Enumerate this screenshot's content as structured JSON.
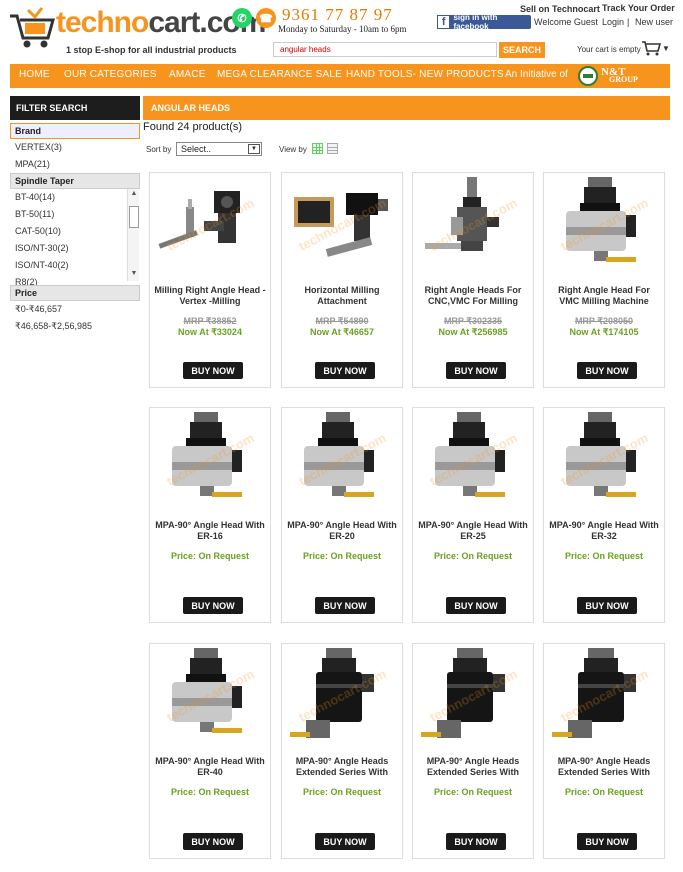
{
  "header": {
    "logo_text_a": "techno",
    "logo_text_b": "cart.com",
    "tagline": "1 stop E-shop for all industrial products",
    "phone_number": "9361 77 87 97",
    "phone_hours": "Monday to Saturday - 10am to 6pm",
    "sell_link": "Sell on Technocart",
    "track_link": "Track Your Order",
    "fb_button": "sign in with facebook",
    "welcome": "Welcome Guest",
    "login": "Login",
    "separator": "|",
    "new_user": "New user",
    "search_value": "angular heads",
    "search_button": "SEARCH",
    "cart_status": "Your cart is empty",
    "whatsapp_icon": "whatsapp-icon",
    "phone_icon": "phone-icon",
    "cart_icon": "shopping-cart-icon"
  },
  "nav": {
    "items": [
      "HOME",
      "OUR CATEGORIES",
      "AMACE",
      "MEGA CLEARANCE SALE",
      "HAND TOOLS- NEW PRODUCTS"
    ],
    "initiative": "An Initiative of",
    "group_logo_l1": "N&T",
    "group_logo_l2": "GROUP"
  },
  "sidebar": {
    "filter_header": "FILTER SEARCH",
    "brand_title": "Brand",
    "brands": [
      "VERTEX(3)",
      "MPA(21)"
    ],
    "taper_title": "Spindle Taper",
    "tapers": [
      "BT-40(14)",
      "BT-50(11)",
      "CAT-50(10)",
      "ISO/NT-30(2)",
      "ISO/NT-40(2)",
      "R8(2)"
    ],
    "price_title": "Price",
    "prices": [
      "₹0-₹46,657",
      "₹46,658-₹2,56,985"
    ]
  },
  "main": {
    "category": "ANGULAR HEADS",
    "found": "Found 24 product(s)",
    "sort_label": "Sort by",
    "sort_value": "Select..",
    "view_label": "View by"
  },
  "products": [
    {
      "name": "Milling Right Angle Head - Vertex -Milling",
      "mrp": "MRP ₹38852",
      "price": "Now At ₹33024",
      "buy": "BUY NOW",
      "img": "vertex-kit"
    },
    {
      "name": "Horizontal Milling Attachment",
      "mrp": "MRP ₹54890",
      "price": "Now At ₹46657",
      "buy": "BUY NOW",
      "img": "horizontal-kit"
    },
    {
      "name": "Right Angle Heads For CNC,VMC For Milling",
      "mrp": "MRP ₹302335",
      "price": "Now At ₹256985",
      "buy": "BUY NOW",
      "img": "cnc-head"
    },
    {
      "name": "Right Angle Head For VMC Milling Machine",
      "mrp": "MRP ₹208050",
      "price": "Now At ₹174105",
      "buy": "BUY NOW",
      "img": "silver-head"
    },
    {
      "name": "MPA-90° Angle Head With ER-16",
      "request": "Price: On Request",
      "buy": "BUY NOW",
      "img": "silver-head"
    },
    {
      "name": "MPA-90° Angle Head With ER-20",
      "request": "Price: On Request",
      "buy": "BUY NOW",
      "img": "silver-head"
    },
    {
      "name": "MPA-90° Angle Head With ER-25",
      "request": "Price: On Request",
      "buy": "BUY NOW",
      "img": "silver-head"
    },
    {
      "name": "MPA-90° Angle Head With ER-32",
      "request": "Price: On Request",
      "buy": "BUY NOW",
      "img": "silver-head"
    },
    {
      "name": "MPA-90° Angle Head With ER-40",
      "request": "Price: On Request",
      "buy": "BUY NOW",
      "img": "silver-head"
    },
    {
      "name": "MPA-90° Angle Heads Extended Series With",
      "request": "Price: On Request",
      "buy": "BUY NOW",
      "img": "black-head"
    },
    {
      "name": "MPA-90° Angle Heads Extended Series With",
      "request": "Price: On Request",
      "buy": "BUY NOW",
      "img": "black-head"
    },
    {
      "name": "MPA-90° Angle Heads Extended Series With",
      "request": "Price: On Request",
      "buy": "BUY NOW",
      "img": "black-head"
    }
  ],
  "watermark": "technocart.com",
  "colors": {
    "accent": "#f7941d",
    "price_green": "#6aa121",
    "dark": "#1d1d1d",
    "facebook": "#3b5998"
  }
}
